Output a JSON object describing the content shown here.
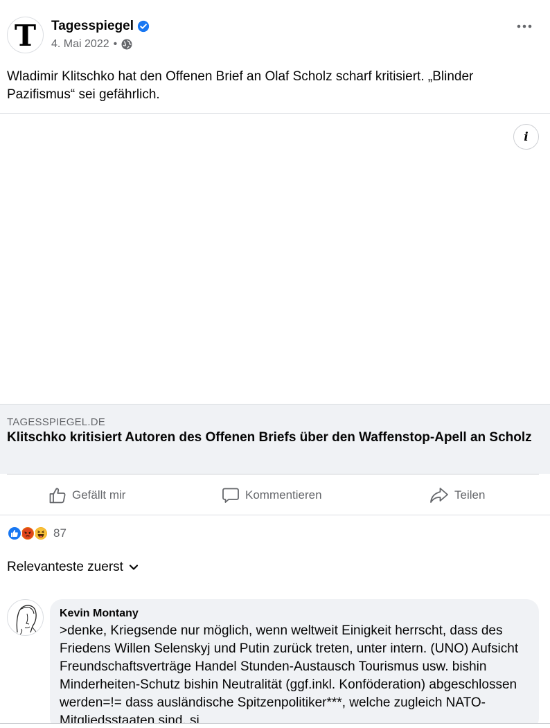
{
  "post": {
    "page_name": "Tagesspiegel",
    "avatar_letter": "T",
    "date": "4. Mai 2022",
    "dot": "•",
    "text": "Wladimir Klitschko hat den Offenen Brief an Olaf Scholz scharf kritisiert. „Blinder Pazifismus“ sei gefährlich.",
    "info_label": "i"
  },
  "link": {
    "domain": "TAGESSPIEGEL.DE",
    "title": "Klitschko kritisiert Autoren des Offenen Briefs über den Waffenstop-Apell an Scholz"
  },
  "actions": {
    "like": "Gefällt mir",
    "comment": "Kommentieren",
    "share": "Teilen"
  },
  "reactions": {
    "count": "87",
    "types": [
      "like-icon",
      "angry-icon",
      "haha-icon"
    ]
  },
  "sort": {
    "label": "Relevanteste zuerst"
  },
  "comment": {
    "author": "Kevin Montany",
    "text": ">denke, Kriegsende nur möglich, wenn weltweit Einigkeit herrscht, dass des Friedens Willen Selenskyj und Putin zurück treten, unter intern. (UNO) Aufsicht Freundschaftsverträge Handel Stunden-Austausch Tourismus usw. bishin Minderheiten-Schutz bishin Neutralität (ggf.inkl. Konföderation) abgeschlossen werden=!= dass ausländische Spitzenpolitiker***, welche zugleich NATO-Mitgliedsstaaten sind, si"
  },
  "colors": {
    "accent": "#1877f2",
    "secondary_text": "#65676b",
    "bubble": "#f0f2f5"
  }
}
